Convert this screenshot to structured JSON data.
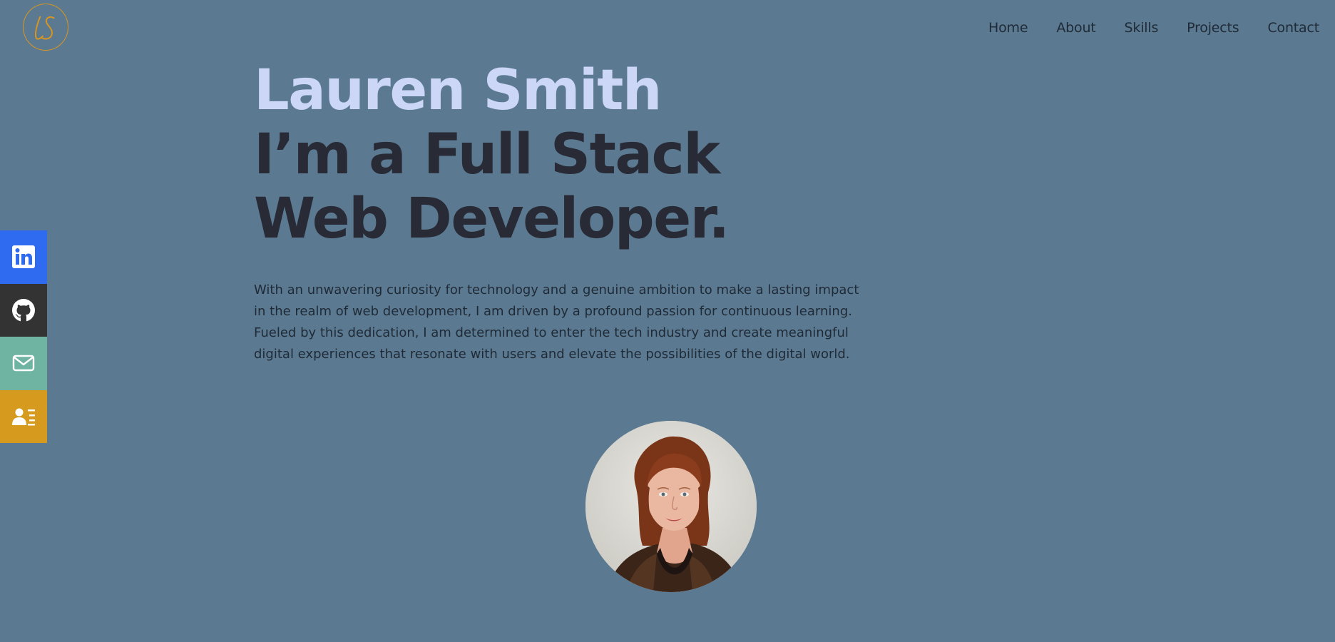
{
  "logo": {
    "monogram": "LS",
    "color": "#d9961e"
  },
  "nav": {
    "items": [
      {
        "label": "Home"
      },
      {
        "label": "About"
      },
      {
        "label": "Skills"
      },
      {
        "label": "Projects"
      },
      {
        "label": "Contact"
      }
    ]
  },
  "hero": {
    "name": "Lauren Smith",
    "tagline": "I’m a Full Stack Web Developer.",
    "bio": "With an unwavering curiosity for technology and a genuine ambition to make a lasting impact in the realm of web development, I am driven by a profound passion for continuous learning. Fueled by this dedication, I am determined to enter the tech industry and create meaningful digital experiences that resonate with users and elevate the possibilities of the digital world."
  },
  "social": {
    "items": [
      {
        "icon": "linkedin-icon",
        "color": "#2e6bf0"
      },
      {
        "icon": "github-icon",
        "color": "#333333"
      },
      {
        "icon": "email-icon",
        "color": "#6fb3a3"
      },
      {
        "icon": "resume-icon",
        "color": "#d59a1e"
      }
    ]
  },
  "colors": {
    "background": "#5b7a91",
    "name": "#ccd6f6",
    "tagline": "#282a35",
    "text": "#1f2a36",
    "accent": "#d9961e"
  }
}
